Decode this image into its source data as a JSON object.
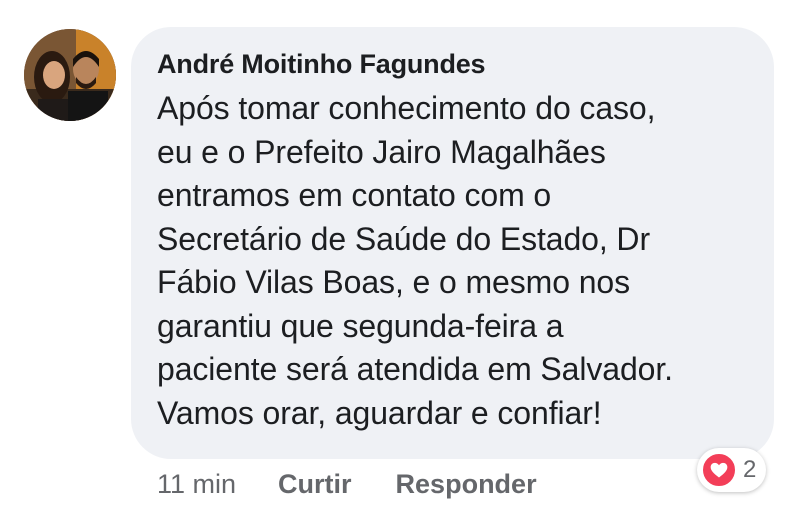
{
  "comment": {
    "author": "André Moitinho Fagundes",
    "text": "Após tomar conhecimento do caso,\neu e o Prefeito Jairo Magalhães\nentramos em contato com o\nSecretário de Saúde do Estado, Dr\nFábio Vilas Boas, e o mesmo nos\ngarantiu que segunda-feira a\npaciente será atendida em Salvador.\nVamos orar,  aguardar e confiar!",
    "time": "11 min",
    "actions": {
      "like_label": "Curtir",
      "reply_label": "Responder"
    },
    "reactions": {
      "icon": "heart-icon",
      "count": "2",
      "color": "#f33e58"
    }
  },
  "colors": {
    "bubble": "#eff1f5",
    "text": "#1c1e21",
    "secondary_text": "#65676b"
  }
}
